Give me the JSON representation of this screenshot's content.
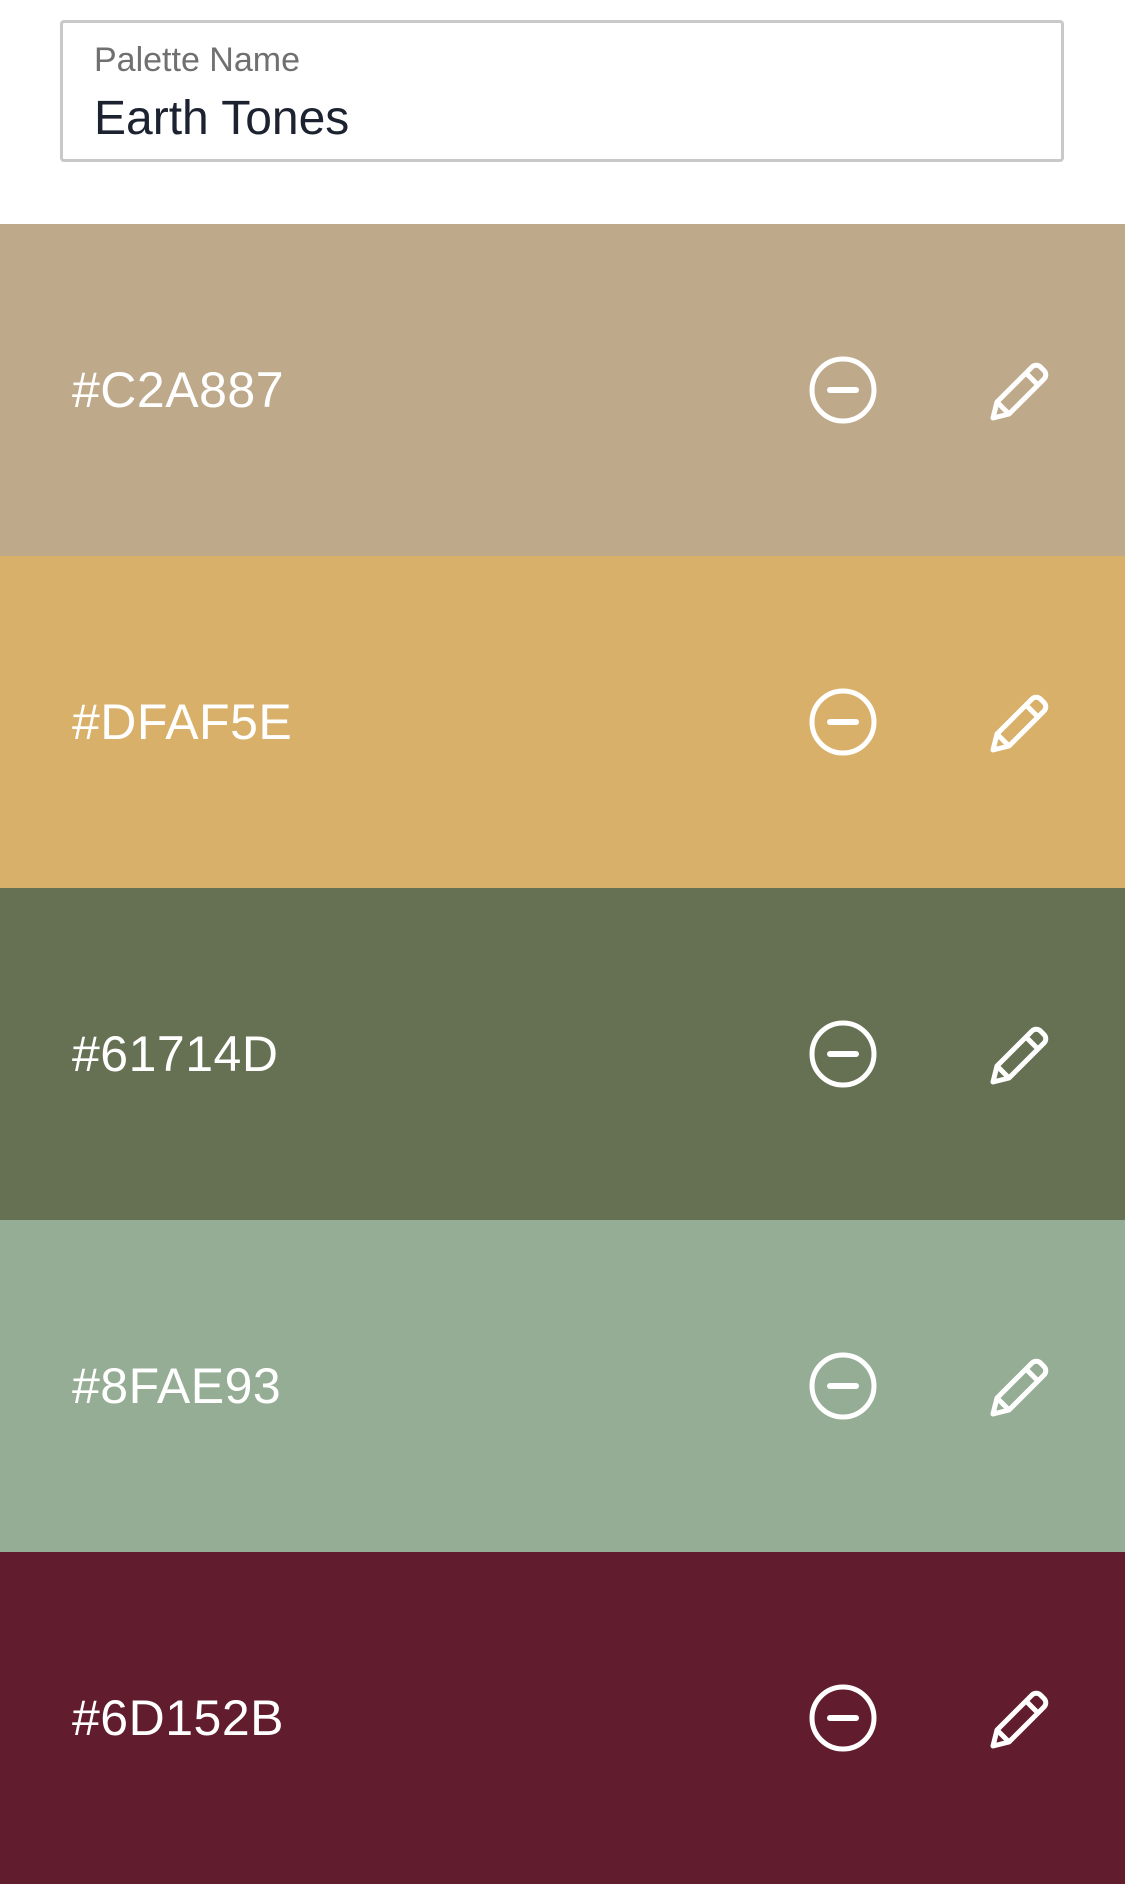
{
  "palette_name": {
    "label": "Palette Name",
    "value": "Earth Tones"
  },
  "swatches": [
    {
      "hex": "#C2A887",
      "color": "#BEA98B",
      "remove_icon": "minus-circle-icon",
      "edit_icon": "pencil-icon"
    },
    {
      "hex": "#DFAF5E",
      "color": "#D8B06A",
      "remove_icon": "minus-circle-icon",
      "edit_icon": "pencil-icon"
    },
    {
      "hex": "#61714D",
      "color": "#667153",
      "remove_icon": "minus-circle-icon",
      "edit_icon": "pencil-icon"
    },
    {
      "hex": "#8FAE93",
      "color": "#95AD94",
      "remove_icon": "minus-circle-icon",
      "edit_icon": "pencil-icon"
    },
    {
      "hex": "#6D152B",
      "color": "#611C2D",
      "remove_icon": "minus-circle-icon",
      "edit_icon": "pencil-icon"
    }
  ]
}
